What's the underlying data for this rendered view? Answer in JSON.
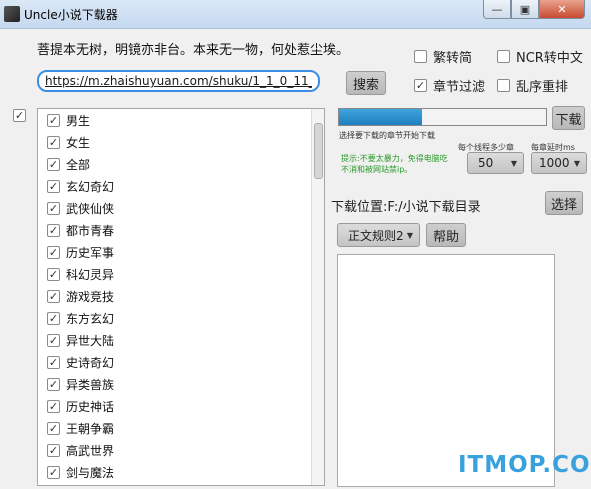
{
  "window": {
    "title": "Uncle小说下载器",
    "min_icon": "—",
    "max_icon": "▣",
    "close_icon": "✕"
  },
  "poem": "菩提本无树，明镜亦非台。本来无一物，何处惹尘埃。",
  "url_input": {
    "value": "https://m.zhaishuyuan.com/shuku/1_1_0_11_"
  },
  "buttons": {
    "search": "搜索",
    "download": "下载",
    "choose": "选择",
    "help": "帮助"
  },
  "options": {
    "traditional": {
      "label": "繁转简",
      "checked": false
    },
    "ncr": {
      "label": "NCR转中文",
      "checked": false
    },
    "chapter_filter": {
      "label": "章节过滤",
      "checked": true
    },
    "shuffle": {
      "label": "乱序重排",
      "checked": false
    }
  },
  "check_mark": "✓",
  "categories": [
    "男生",
    "女生",
    "全部",
    "玄幻奇幻",
    "武侠仙侠",
    "都市青春",
    "历史军事",
    "科幻灵异",
    "游戏竞技",
    "东方玄幻",
    "异世大陆",
    "史诗奇幻",
    "异类兽族",
    "历史神话",
    "王朝争霸",
    "高武世界",
    "剑与魔法"
  ],
  "progress": {
    "fraction": 0.4,
    "caption": "选择要下载的章节开始下载"
  },
  "threads": {
    "label": "每个线程多少章",
    "value": "50"
  },
  "delay": {
    "label": "每章延时ms",
    "value": "1000"
  },
  "hint": "提示:不要太暴力，免得电脑吃不消和被网站禁ip。",
  "location": {
    "label": "下载位置:",
    "path": "F:/小说下载目录"
  },
  "rule_dropdown": {
    "value": "正文规则2"
  },
  "watermark": "ITMOP.COM",
  "colors": {
    "accent": "#3a8ee6",
    "progress": "#1f7fbf",
    "hint": "#2a9a2a",
    "watermark": "#3aa1df"
  }
}
